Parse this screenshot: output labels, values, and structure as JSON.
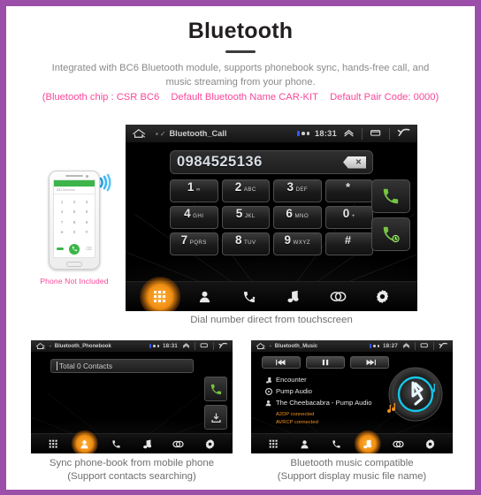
{
  "header": {
    "title": "Bluetooth",
    "description_line1": "Integrated with BC6 Bluetooth module, supports phonebook sync, hands-free call, and",
    "description_line2": "music streaming from your phone.",
    "spec_chip": "(Bluetooth chip : CSR BC6",
    "spec_name": "Default Bluetooth Name CAR-KIT",
    "spec_pair": "Default Pair Code: 0000)",
    "accent_pink": "#f9479a",
    "border_purple": "#9b4fa8"
  },
  "main_screen": {
    "status": {
      "title": "Bluetooth_Call",
      "time": "18:31",
      "home_icon": "home-icon",
      "chevron_icon": "chevron-up-icon",
      "window_icon": "window-icon",
      "back_icon": "back-arrow-icon"
    },
    "dial_number": "0984525136",
    "backspace_icon": "backspace-icon",
    "keys": [
      {
        "digit": "1",
        "letters": "∞"
      },
      {
        "digit": "2",
        "letters": "ABC"
      },
      {
        "digit": "3",
        "letters": "DEF"
      },
      {
        "digit": "*",
        "letters": ""
      },
      {
        "digit": "4",
        "letters": "GHI"
      },
      {
        "digit": "5",
        "letters": "JKL"
      },
      {
        "digit": "6",
        "letters": "MNO"
      },
      {
        "digit": "0",
        "letters": "+"
      },
      {
        "digit": "7",
        "letters": "PQRS"
      },
      {
        "digit": "8",
        "letters": "TUV"
      },
      {
        "digit": "9",
        "letters": "WXYZ"
      },
      {
        "digit": "#",
        "letters": ""
      }
    ],
    "call_button_icon": "phone-call-icon",
    "redial_button_icon": "phone-redial-icon",
    "nav": [
      {
        "name": "keypad",
        "icon": "keypad-icon",
        "active": true
      },
      {
        "name": "contacts",
        "icon": "contact-icon",
        "active": false
      },
      {
        "name": "call-history",
        "icon": "call-history-icon",
        "active": false
      },
      {
        "name": "music",
        "icon": "music-note-icon",
        "active": false
      },
      {
        "name": "link",
        "icon": "link-icon",
        "active": false
      },
      {
        "name": "settings",
        "icon": "gear-icon",
        "active": false
      }
    ],
    "caption": "Dial number direct from touchscreen"
  },
  "phone_mock": {
    "note": "Phone Not Included",
    "bluetooth_icon": "bluetooth-signal-icon",
    "input_hint": "081 5xxxxxx",
    "keys": [
      "1",
      "2",
      "3",
      "4",
      "5",
      "6",
      "7",
      "8",
      "9",
      "∗",
      "0",
      "#"
    ],
    "call_icon": "phone-call-icon",
    "green_hex": "#3cb54a"
  },
  "phonebook_screen": {
    "status": {
      "title": "Bluetooth_Phonebook",
      "time": "18:31"
    },
    "search_value": "Total 0 Contacts",
    "call_button_icon": "phone-call-icon",
    "download_button_icon": "download-contacts-icon",
    "nav": [
      {
        "name": "keypad",
        "icon": "keypad-icon",
        "active": false
      },
      {
        "name": "contacts",
        "icon": "contact-icon",
        "active": true
      },
      {
        "name": "call-history",
        "icon": "call-history-icon",
        "active": false
      },
      {
        "name": "music",
        "icon": "music-note-icon",
        "active": false
      },
      {
        "name": "link",
        "icon": "link-icon",
        "active": false
      },
      {
        "name": "settings",
        "icon": "gear-icon",
        "active": false
      }
    ],
    "caption_line1": "Sync phone-book from mobile phone",
    "caption_line2": "(Support contacts searching)"
  },
  "music_screen": {
    "status": {
      "title": "Bluetooth_Music",
      "time": "18:27"
    },
    "transport": [
      {
        "name": "previous",
        "icon": "skip-previous-icon"
      },
      {
        "name": "pause",
        "icon": "pause-icon"
      },
      {
        "name": "next",
        "icon": "skip-next-icon"
      }
    ],
    "track_title": "Encounter",
    "album": "Pump Audio",
    "artist": "The Cheebacabra - Pump Audio",
    "a2dp_status": "A2DP connected",
    "avrcp_status": "AVRCP connected",
    "status_color": "#f0921e",
    "disc_icon": "bluetooth-disc-icon",
    "nav": [
      {
        "name": "keypad",
        "icon": "keypad-icon",
        "active": false
      },
      {
        "name": "contacts",
        "icon": "contact-icon",
        "active": false
      },
      {
        "name": "call-history",
        "icon": "call-history-icon",
        "active": false
      },
      {
        "name": "music",
        "icon": "music-note-icon",
        "active": true
      },
      {
        "name": "link",
        "icon": "link-icon",
        "active": false
      },
      {
        "name": "settings",
        "icon": "gear-icon",
        "active": false
      }
    ],
    "caption_line1": "Bluetooth music compatible",
    "caption_line2": "(Support display music file name)"
  }
}
